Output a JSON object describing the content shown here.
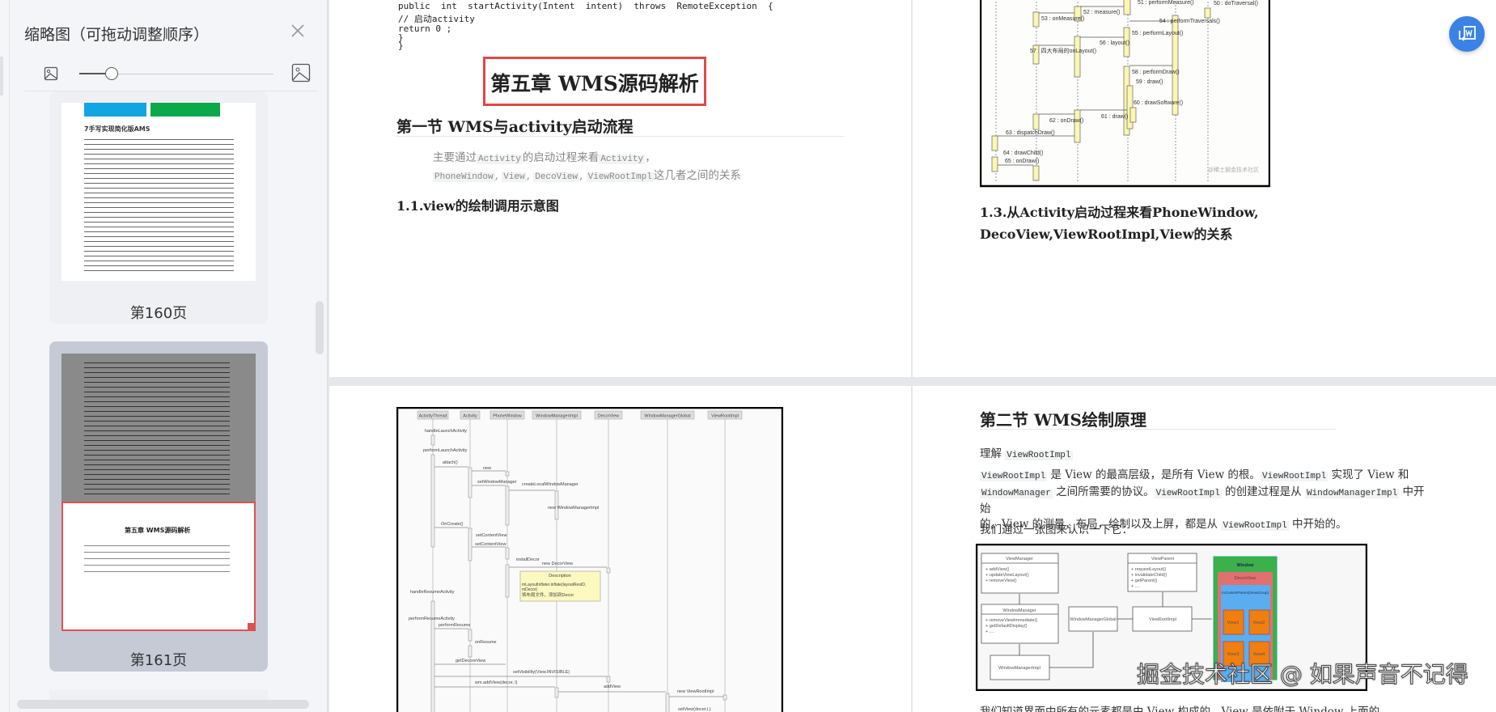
{
  "sidebar": {
    "title": "缩略图（可拖动调整顺序）",
    "thumbnails": [
      {
        "label": "第160页",
        "heading": "7手写实现简化版AMS"
      },
      {
        "label": "第161页",
        "heading": "第五章 WMS源码解析"
      }
    ],
    "zoom_slider_value": 0.17
  },
  "page161": {
    "code": [
      "public  int  startActivity(Intent  intent)  throws  RemoteException  {",
      "// 启动activity",
      "return 0 ;",
      "}",
      "}"
    ],
    "chapter_title": "第五章 WMS源码解析",
    "section1_title": "第一节 WMS与activity启动流程",
    "intro": {
      "t1": "主要通过",
      "c1": "Activity",
      "t2": "的启动过程来看",
      "c2": "Activity",
      "t3": "，",
      "c3": "PhoneWindow",
      "c4": "View",
      "c5": "DecoView",
      "c6": "ViewRootImpl",
      "t4": "这几者之间的关系",
      "sep": ","
    },
    "sub_1_1": "1.1.view的绘制调用示意图"
  },
  "page_top_right": {
    "diagram_labels": [
      "51 : performMeasure()",
      "52 : measure()",
      "53 : onMeasure()",
      "54 : performTraversals()",
      "55 : performLayout()",
      "56 : layout()",
      "57 : 四大布局的onLayout()",
      "58 : performDraw()",
      "59 : draw()",
      "60 : drawSoftware()",
      "61 : draw()",
      "62 : onDraw()",
      "63 : dispatchDraw()",
      "64 : drawChild()",
      "65 : onDraw()",
      "50 : doTraversal()"
    ],
    "diagram_watermark": "@稀土掘金技术社区",
    "sub_1_3_line1": "1.3.从Activity启动过程来看PhoneWindow,",
    "sub_1_3_line2": "DecoView,ViewRootImpl,View的关系"
  },
  "page_bottom_left": {
    "lifelines": [
      "ActivityThread",
      "Activity",
      "PhoneWindow",
      "WindowManagerImpl",
      "DecorView",
      "WindowManagerGlobal",
      "ViewRootImpl"
    ],
    "messages": [
      "handleLaunchActivity",
      "performLaunchActivity",
      "attach()",
      "new",
      "setWindowManager",
      "createLocalWindowManager",
      "new WindowManagerImpl",
      "OnCreate()",
      "setContentView",
      "setContentView",
      "installDecor",
      "new DecorView",
      "handleResumeActivity",
      "performResumeActivity",
      "performResume",
      "onResume",
      "getDecoreView",
      "setVisibility(View.INVISIBLE)",
      "wm.addView(decor, l)",
      "addView",
      "new ViewRootImpl",
      "setView(docer,l,)"
    ],
    "note_title": "Description",
    "note_line1": "mLayoutInflater.inflate(layoutResID,",
    "note_line2": "mDecor)",
    "note_line3": "将布局文件，添加到Decor"
  },
  "page_bottom_right": {
    "section2_title": "第二节 WMS绘制原理",
    "understand": "理解",
    "understand_code": "ViewRootImpl",
    "para": {
      "c1": "ViewRootImpl",
      "t1": " 是 View 的最高层级，是所有 View 的根。",
      "c2": "ViewRootImpl",
      "t2": " 实现了 View 和",
      "c3": "WindowManager",
      "t3": " 之间所需要的协议。",
      "c4": "ViewRootImpl",
      "t4": " 的创建过程是从 ",
      "c5": "WindowManagerImpl",
      "t5": " 中开始",
      "t6": "的。View 的测量，布局，绘制以及上屏，都是从 ",
      "c6": "ViewRootImpl",
      "t7": " 中开始的。"
    },
    "through": "我们通过一张图来认识一下它：",
    "diagram": {
      "view_manager": "ViewManager",
      "view_manager_methods": [
        "+ addView()",
        "+ updateViewLayout()",
        "+ removeView()"
      ],
      "window_manager": "WindowManager",
      "window_manager_methods": [
        "+ removeViewImmediate()",
        "+ getDefaultDisplay()",
        "+ ...."
      ],
      "window_manager_impl": "WindowManagerImpl",
      "window_manager_global": "WindowManagerGlobal",
      "view_root_impl": "ViewRootImpl",
      "view_parent": "ViewParent",
      "view_parent_methods": [
        "+ requestLayout()",
        "+ invalidateChild()",
        "+ getParent()",
        "+ ...."
      ],
      "window": "Window",
      "decor_view": "DecorView",
      "content_parent": "mContentParent(ViewGroup)",
      "views": [
        "View1",
        "View2",
        "View3",
        "View4"
      ]
    },
    "last_line": "我们知道界面中所有的元素都是由 View 构成的，View 是依附于 Window 上面的。"
  },
  "watermark": "掘金技术社区 @ 如果声音不记得",
  "colors": {
    "accent": "#3b82e6",
    "highlight_red": "#e04848",
    "window_green": "#3cb04a",
    "decor_red": "#e07070",
    "content_blue": "#5aaef0",
    "view_orange": "#f07f10"
  }
}
